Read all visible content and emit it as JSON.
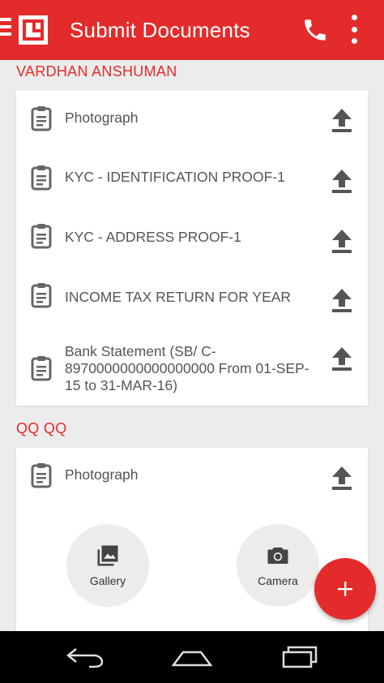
{
  "appbar": {
    "title": "Submit Documents",
    "icons": [
      "menu-icon",
      "app-logo",
      "phone-icon",
      "more-vert-icon"
    ],
    "color": "#e32b2b"
  },
  "sections": [
    {
      "name": "VARDHAN ANSHUMAN",
      "documents": [
        {
          "label": "Photograph"
        },
        {
          "label": "KYC - IDENTIFICATION PROOF-1"
        },
        {
          "label": "KYC - ADDRESS PROOF-1"
        },
        {
          "label": "INCOME TAX RETURN FOR YEAR"
        },
        {
          "label": "Bank Statement  (SB/ C-8970000000000000000 From 01-SEP-15 to 31-MAR-16)"
        }
      ]
    },
    {
      "name": "QQ QQ",
      "documents": [
        {
          "label": "Photograph"
        }
      ]
    }
  ],
  "picker": {
    "gallery_label": "Gallery",
    "camera_label": "Camera"
  },
  "fab": {
    "icon": "plus-icon"
  },
  "navbar": {
    "icons": [
      "back-icon",
      "home-icon",
      "recents-icon"
    ]
  }
}
